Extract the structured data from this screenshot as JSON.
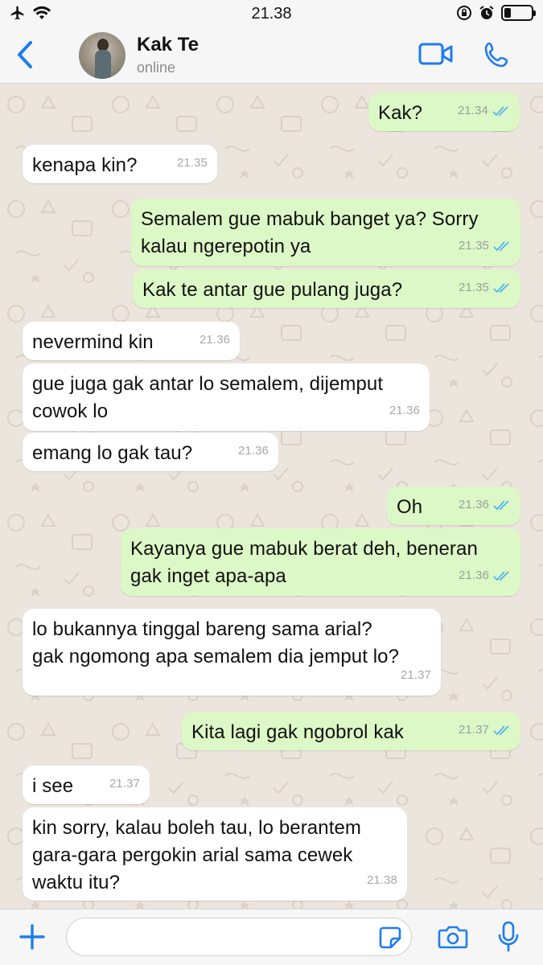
{
  "status_bar": {
    "time": "21.38",
    "battery_level": 0.25
  },
  "header": {
    "contact_name": "Kak Te",
    "contact_status": "online"
  },
  "messages": [
    {
      "dir": "out",
      "text": "Kak?",
      "time": "21.34",
      "read": true
    },
    {
      "dir": "in",
      "text": "kenapa kin?",
      "time": "21.35"
    },
    {
      "dir": "out",
      "text": "Semalem gue mabuk banget ya? Sorry\nkalau ngerepotin ya",
      "time": "21.35",
      "read": true
    },
    {
      "dir": "out",
      "text": "Kak te antar gue pulang juga?",
      "time": "21.35",
      "read": true
    },
    {
      "dir": "in",
      "text": "nevermind kin",
      "time": "21.36"
    },
    {
      "dir": "in",
      "text": "gue juga gak antar lo semalem, dijemput\ncowok lo",
      "time": "21.36"
    },
    {
      "dir": "in",
      "text": "emang lo gak tau?",
      "time": "21.36"
    },
    {
      "dir": "out",
      "text": "Oh",
      "time": "21.36",
      "read": true
    },
    {
      "dir": "out",
      "text": "Kayanya gue mabuk berat deh, beneran\ngak inget apa-apa",
      "time": "21.36",
      "read": true
    },
    {
      "dir": "in",
      "text": "lo bukannya tinggal bareng sama arial?\ngak ngomong apa semalem dia jemput lo?",
      "time": "21.37"
    },
    {
      "dir": "out",
      "text": "Kita lagi gak ngobrol kak",
      "time": "21.37",
      "read": true
    },
    {
      "dir": "in",
      "text": "i see",
      "time": "21.37"
    },
    {
      "dir": "in",
      "text": "kin sorry, kalau boleh tau, lo berantem\ngara-gara pergokin arial sama cewek\nwaktu itu?",
      "time": "21.38"
    }
  ],
  "input": {
    "placeholder": ""
  },
  "colors": {
    "accent": "#1d7cf2",
    "outgoing_bubble": "#dcf8c6",
    "incoming_bubble": "#ffffff",
    "chat_background": "#ece5dd",
    "read_ticks": "#4fb6ec"
  }
}
